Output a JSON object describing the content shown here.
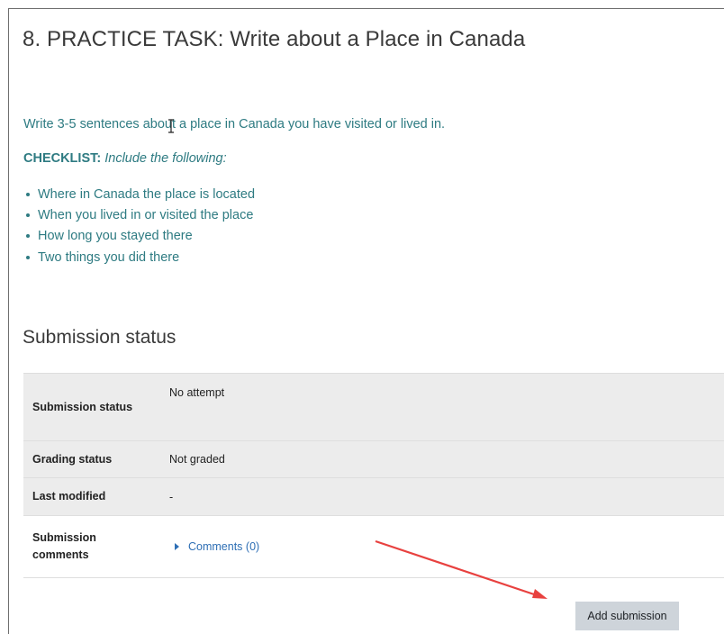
{
  "page": {
    "title": "8. PRACTICE TASK: Write about a Place in Canada"
  },
  "intro_text": "Write 3-5 sentences about a place in Canada you have visited or lived in.",
  "checklist": {
    "label": "CHECKLIST:",
    "instruction": "Include the following:",
    "items": [
      "Where in Canada the place is located",
      "When you lived in or visited the place",
      "How long you stayed there",
      "Two things you did there"
    ]
  },
  "submission": {
    "heading": "Submission status",
    "rows": [
      {
        "label": "Submission status",
        "value": "No attempt"
      },
      {
        "label": "Grading status",
        "value": "Not graded"
      },
      {
        "label": "Last modified",
        "value": "-"
      },
      {
        "label": "Submission comments",
        "value": "Comments (0)"
      }
    ],
    "add_button_label": "Add submission"
  },
  "icons": {
    "text_cursor": "text-cursor-icon",
    "expand": "triangle-right-icon",
    "annotation_arrow": "red-arrow-icon"
  },
  "colors": {
    "text_teal": "#2e7b82",
    "link_blue": "#2e6fb5",
    "annotation_red": "#e8413f",
    "button_bg": "#ced4da"
  }
}
